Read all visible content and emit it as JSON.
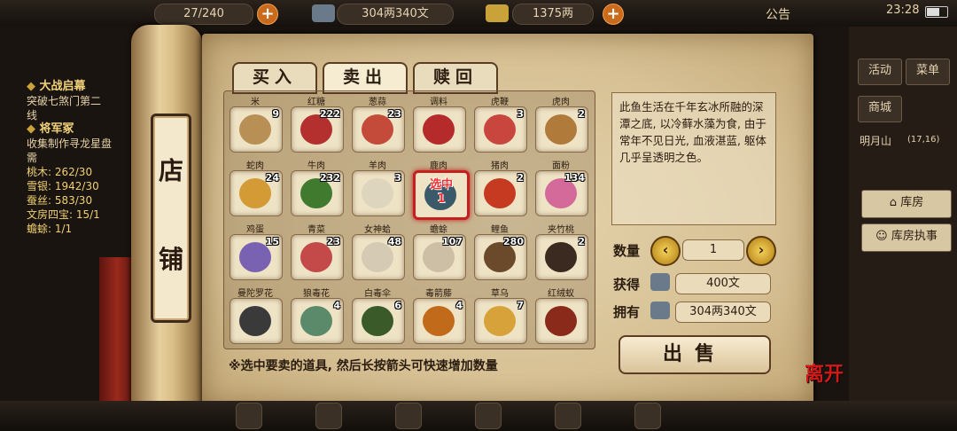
{
  "topbar": {
    "capacity": "27/240",
    "money_copper": "304两340文",
    "money_silver": "1375两",
    "announce": "公告",
    "time": "23:28"
  },
  "quests": {
    "q1_title": "大战启幕",
    "q1_desc": "突破七煞门第二",
    "q1_desc2": "线",
    "q2_title": "将军冢",
    "q2_desc": "收集制作寻龙星盘",
    "q2_desc2": "需",
    "req1": "桃木: 262/30",
    "req2": "雪银: 1942/30",
    "req3": "蚕丝: 583/30",
    "req4": "文房四宝: 15/1",
    "req5": "蟾蜍: 1/1"
  },
  "scroll": {
    "char1": "店",
    "char2": "铺"
  },
  "tabs": {
    "buy": "买入",
    "sell": "卖出",
    "redeem": "赎回"
  },
  "items": [
    {
      "name": "米",
      "count": "9",
      "color": "#b88f55"
    },
    {
      "name": "红糖",
      "count": "222",
      "color": "#b3302f"
    },
    {
      "name": "葱蒜",
      "count": "23",
      "color": "#c44a3a"
    },
    {
      "name": "调料",
      "count": "",
      "color": "#b52a2a"
    },
    {
      "name": "虎鞭",
      "count": "3",
      "color": "#c8463e"
    },
    {
      "name": "虎肉",
      "count": "2",
      "color": "#b07a3a"
    },
    {
      "name": "蛇肉",
      "count": "24",
      "color": "#d39a36"
    },
    {
      "name": "牛肉",
      "count": "232",
      "color": "#3f7a2e"
    },
    {
      "name": "羊肉",
      "count": "3",
      "color": "#ddd5bd"
    },
    {
      "name": "鹿肉",
      "count": "",
      "color": "#3a5a6a",
      "sel": "选中",
      "selnum": "1"
    },
    {
      "name": "猪肉",
      "count": "2",
      "color": "#c63a22"
    },
    {
      "name": "面粉",
      "count": "134",
      "color": "#d36a9a"
    },
    {
      "name": "鸡蛋",
      "count": "15",
      "color": "#7a62b2"
    },
    {
      "name": "青菜",
      "count": "23",
      "color": "#c44a4a"
    },
    {
      "name": "女神蛤",
      "count": "48",
      "color": "#d5cbb4"
    },
    {
      "name": "蟾蜍",
      "count": "107",
      "color": "#cdbfa6"
    },
    {
      "name": "鲤鱼",
      "count": "280",
      "color": "#6a4a2a"
    },
    {
      "name": "夹竹桃",
      "count": "2",
      "color": "#3a2a20"
    },
    {
      "name": "曼陀罗花",
      "count": "",
      "color": "#3a3a3a"
    },
    {
      "name": "狼毒花",
      "count": "4",
      "color": "#5a8a6a"
    },
    {
      "name": "白毒伞",
      "count": "6",
      "color": "#3a5a2a"
    },
    {
      "name": "毒箭藤",
      "count": "4",
      "color": "#c06a1a"
    },
    {
      "name": "草乌",
      "count": "7",
      "color": "#d8a23a"
    },
    {
      "name": "红绒蚁",
      "count": "",
      "color": "#8a2a1a"
    }
  ],
  "hint": "※选中要卖的道具, 然后长按箭头可快速增加数量",
  "description": "此鱼生活在千年玄冰所融的深潭之底, 以冷藓水藻为食, 由于常年不见日光, 血液湛蓝, 躯体几乎呈透明之色。",
  "trade": {
    "qty_label": "数量",
    "qty": "1",
    "gain_label": "获得",
    "gain": "400文",
    "own_label": "拥有",
    "own": "304两340文",
    "sell_label": "出售"
  },
  "right": {
    "activity": "活动",
    "menu": "菜单",
    "shop": "商城",
    "location": "明月山",
    "coords": "(17,16)",
    "warehouse": "库房",
    "warehouse_exec": "库房执事"
  },
  "leave": "离开"
}
